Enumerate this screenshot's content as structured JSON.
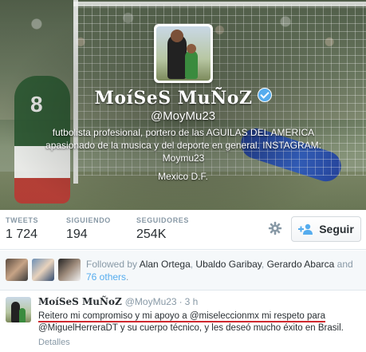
{
  "profile": {
    "display_name": "MoíSeS MuÑoZ",
    "screen_name": "@MoyMu23",
    "bio_line1": "futbolista profesional, portero de las AGUILAS DEL AMERICA",
    "bio_line2": "apasionado de la musica y del deporte en general. INSTAGRAM:",
    "bio_line3": "Moymu23",
    "location": "Mexico D.F.",
    "verified_icon": "verified-badge-icon",
    "header_number": "8"
  },
  "stats": {
    "tweets_label": "TWEETS",
    "tweets_value": "1 724",
    "following_label": "SIGUIENDO",
    "following_value": "194",
    "followers_label": "SEGUIDORES",
    "followers_value": "254K"
  },
  "actions": {
    "settings_icon": "gear-icon",
    "follow_label": "Seguir",
    "follow_icon": "add-user-icon"
  },
  "followed_by": {
    "prefix": "Followed by ",
    "user1": "Alan Ortega",
    "sep1": ", ",
    "user2": "Ubaldo Garibay",
    "sep2": ", ",
    "user3": "Gerardo Abarca",
    "sep3": " and",
    "others": "76 others",
    "suffix": "."
  },
  "tweet": {
    "name": "MoíSeS MuÑoZ",
    "handle": "@MoyMu23",
    "dot": "·",
    "time": "3 h",
    "text_part1": "Reitero mi compromiso y mi apoyo a ",
    "mention1": "@miseleccionmx",
    "text_part2": " mi respeto para",
    "mention2": "@MiguelHerreraDT",
    "text_part3": " y su cuerpo técnico, y les deseó mucho éxito en Brasil.",
    "details_label": "Detalles"
  },
  "colors": {
    "accent": "#55acee",
    "underline": "#d0282e",
    "muted": "#8899a6",
    "text": "#292f33"
  }
}
